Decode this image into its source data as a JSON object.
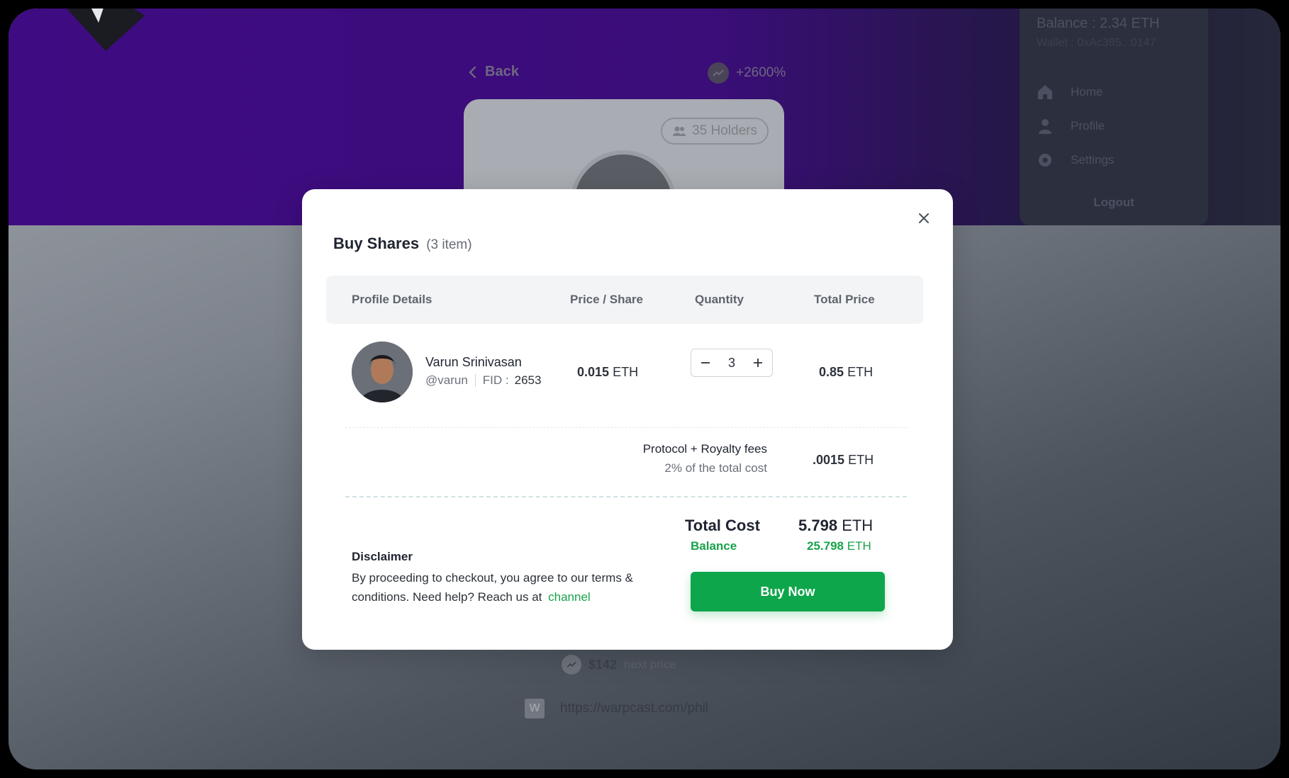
{
  "background": {
    "back_label": "Back",
    "growth": "+2600%",
    "holders": "35 Holders",
    "menu": {
      "balance": "Balance : 2.34 ETH",
      "wallet": "Wallet : 0xAc385...0147",
      "items": [
        {
          "label": "Home",
          "icon": "home-icon"
        },
        {
          "label": "Profile",
          "icon": "user-icon"
        },
        {
          "label": "Settings",
          "icon": "gear-icon"
        }
      ],
      "logout": "Logout"
    },
    "next_price_value": "$142",
    "next_price_label": "next price",
    "warpcast_badge": "W",
    "warpcast_url": "https://warpcast.com/phil"
  },
  "modal": {
    "title": "Buy Shares",
    "item_count": "(3 item)",
    "columns": {
      "profile": "Profile Details",
      "price": "Price / Share",
      "quantity": "Quantity",
      "total": "Total Price"
    },
    "row": {
      "name": "Varun Srinivasan",
      "handle": "@varun",
      "fid_label": "FID :",
      "fid_value": "2653",
      "price_value": "0.015",
      "price_unit": "ETH",
      "quantity": "3",
      "total_value": "0.85",
      "total_unit": "ETH"
    },
    "fees": {
      "label": "Protocol + Royalty fees",
      "sub": "2% of the total cost",
      "value": ".0015",
      "unit": "ETH"
    },
    "summary": {
      "total_label": "Total Cost",
      "total_value": "5.798",
      "total_unit": "ETH",
      "balance_label": "Balance",
      "balance_value": "25.798",
      "balance_unit": "ETH"
    },
    "disclaimer": {
      "title": "Disclaimer",
      "text": "By proceeding to checkout, you agree to our terms & conditions. Need help? Reach us at",
      "link": "channel"
    },
    "buy_button": "Buy Now"
  },
  "colors": {
    "accent_green": "#0ea64b",
    "hero_purple": "#3f0b82"
  }
}
